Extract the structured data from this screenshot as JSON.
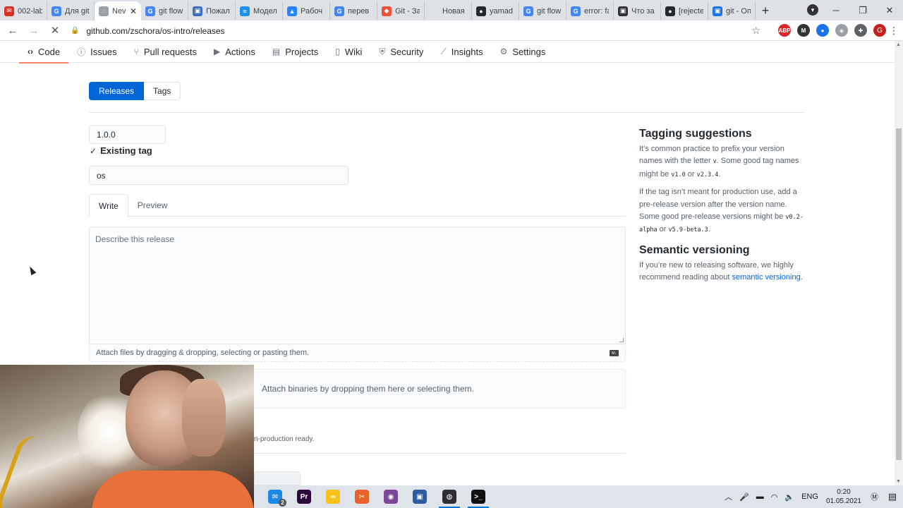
{
  "browser": {
    "tabs": [
      {
        "title": "002-lab",
        "color": "#d93025",
        "glyph": "✉"
      },
      {
        "title": "Для git",
        "color": "#4285f4",
        "glyph": "G"
      },
      {
        "title": "Nev",
        "color": "#9aa0a6",
        "glyph": "◌",
        "active": true
      },
      {
        "title": "git flow",
        "color": "#4285f4",
        "glyph": "G"
      },
      {
        "title": "Пожал",
        "color": "#3c6ebd",
        "glyph": "▣"
      },
      {
        "title": "Модел",
        "color": "#1f8ff0",
        "glyph": "≈"
      },
      {
        "title": "Рабоч",
        "color": "#2684ff",
        "glyph": "▲"
      },
      {
        "title": "перев",
        "color": "#4285f4",
        "glyph": "G"
      },
      {
        "title": "Git - За",
        "color": "#f05033",
        "glyph": "◆"
      },
      {
        "title": "Новая вкла",
        "color": "#dee1e6",
        "glyph": ""
      },
      {
        "title": "yamad",
        "color": "#24292e",
        "glyph": "●"
      },
      {
        "title": "git flow",
        "color": "#4285f4",
        "glyph": "G"
      },
      {
        "title": "error: fa",
        "color": "#4285f4",
        "glyph": "G"
      },
      {
        "title": "Что за",
        "color": "#333333",
        "glyph": "▣"
      },
      {
        "title": "[rejecte",
        "color": "#24292e",
        "glyph": "●"
      },
      {
        "title": "git - Оп",
        "color": "#1a73e8",
        "glyph": "▣"
      }
    ],
    "url": "github.com/zschora/os-intro/releases",
    "profile_initial": "G",
    "extensions": [
      {
        "name": "adblock-icon",
        "label": "ABP",
        "color": "#d5272b"
      },
      {
        "name": "extension-m-icon",
        "label": "M",
        "color": "#333333"
      },
      {
        "name": "extension-blue-icon",
        "label": "●",
        "color": "#1a73e8"
      },
      {
        "name": "extension-shield-icon",
        "label": "◈",
        "color": "#9aa0a6"
      },
      {
        "name": "puzzle-icon",
        "label": "✚",
        "color": "#5f6368"
      }
    ]
  },
  "repo_nav": [
    {
      "label": "Code",
      "icon": "‹›",
      "selected": true
    },
    {
      "label": "Issues",
      "icon": "ⓘ"
    },
    {
      "label": "Pull requests",
      "icon": "⑂"
    },
    {
      "label": "Actions",
      "icon": "▶"
    },
    {
      "label": "Projects",
      "icon": "▤"
    },
    {
      "label": "Wiki",
      "icon": "▯"
    },
    {
      "label": "Security",
      "icon": "⛨"
    },
    {
      "label": "Insights",
      "icon": "⟋"
    },
    {
      "label": "Settings",
      "icon": "⚙"
    }
  ],
  "subnav": {
    "releases": "Releases",
    "tags": "Tags"
  },
  "form": {
    "tag_value": "1.0.0",
    "existing_tag": "Existing tag",
    "title_value": "os",
    "write_tab": "Write",
    "preview_tab": "Preview",
    "body_placeholder": "Describe this release",
    "attach_files": "Attach files by dragging & dropping, selecting or pasting them.",
    "markdown_badge": "M↓",
    "attach_binaries": "Attach binaries by dropping them here or selecting them.",
    "prerelease_note": "n-production ready."
  },
  "sidebar": {
    "tagging_title": "Tagging suggestions",
    "tagging_p1_a": "It’s common practice to prefix your version names with the letter ",
    "tagging_p1_v": "v",
    "tagging_p1_b": ". Some good tag names might be ",
    "tagging_p1_c1": "v1.0",
    "tagging_p1_or": " or ",
    "tagging_p1_c2": "v2.3.4",
    "tagging_p1_end": ".",
    "tagging_p2_a": "If the tag isn’t meant for production use, add a pre-release version after the version name. Some good pre-release versions might be ",
    "tagging_p2_c1": "v0.2-alpha",
    "tagging_p2_or": " or ",
    "tagging_p2_c2": "v5.9-beta.3",
    "tagging_p2_end": ".",
    "semver_title": "Semantic versioning",
    "semver_p_a": "If you’re new to releasing software, we highly recommend reading about ",
    "semver_link": "semantic versioning",
    "semver_end": "."
  },
  "taskbar": {
    "apps": [
      {
        "name": "mail-icon",
        "glyph": "✉",
        "color": "#1e88e5",
        "badge": "2"
      },
      {
        "name": "premiere-icon",
        "glyph": "Pr",
        "color": "#2a0a3a"
      },
      {
        "name": "infinity-icon",
        "glyph": "∞",
        "color": "#f5c21b"
      },
      {
        "name": "tool-icon",
        "glyph": "✂",
        "color": "#e8632a"
      },
      {
        "name": "tor-icon",
        "glyph": "◉",
        "color": "#7d4698"
      },
      {
        "name": "virtualbox-icon",
        "glyph": "▣",
        "color": "#2d5aa0"
      },
      {
        "name": "obs-icon",
        "glyph": "◍",
        "color": "#302e31",
        "running": true
      },
      {
        "name": "terminal-icon",
        "glyph": ">_",
        "color": "#111111",
        "running": true
      }
    ],
    "language": "ENG",
    "time": "0:20",
    "date": "01.05.2021"
  }
}
